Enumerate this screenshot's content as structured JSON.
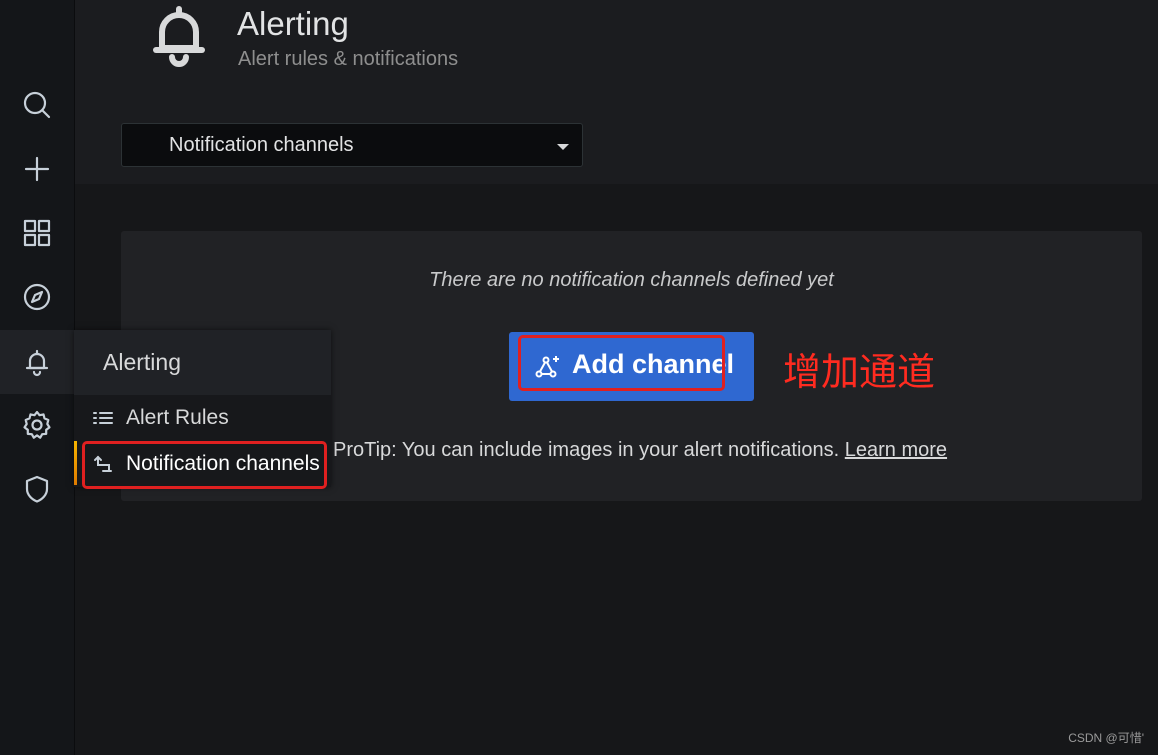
{
  "header": {
    "title": "Alerting",
    "subtitle": "Alert rules & notifications",
    "icon": "bell-icon"
  },
  "sidebar": {
    "items": [
      {
        "name": "search",
        "icon": "search-icon"
      },
      {
        "name": "create",
        "icon": "plus-icon"
      },
      {
        "name": "dashboards",
        "icon": "apps-icon"
      },
      {
        "name": "explore",
        "icon": "compass-icon"
      },
      {
        "name": "alerting",
        "icon": "bell-icon",
        "active": true
      },
      {
        "name": "configuration",
        "icon": "gear-icon"
      },
      {
        "name": "server-admin",
        "icon": "shield-icon"
      }
    ]
  },
  "tab_select": {
    "value": "Notification channels"
  },
  "empty_state": {
    "message": "There are no notification channels defined yet",
    "add_button_label": "Add channel",
    "protip_text": "ProTip: You can include images in your alert notifications. ",
    "learn_more_label": "Learn more"
  },
  "annotation": {
    "text": "增加通道",
    "color": "#ff2b20"
  },
  "flyout": {
    "title": "Alerting",
    "items": [
      {
        "label": "Alert Rules",
        "icon": "list-icon"
      },
      {
        "label": "Notification channels",
        "icon": "comment-alt-share-icon",
        "active": true
      }
    ]
  },
  "watermark": "CSDN @可惜'",
  "colors": {
    "primary_button": "#2f68d1",
    "highlight_box": "#e02020",
    "active_indicator": "#f7b500"
  }
}
